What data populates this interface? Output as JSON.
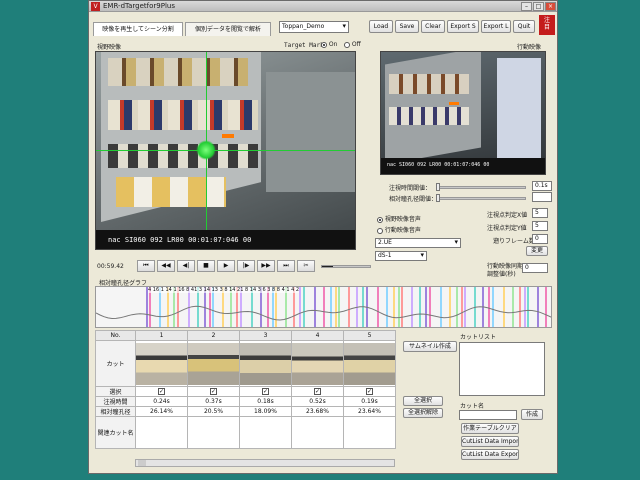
{
  "window": {
    "title": "EMR-dTargetfor9Plus",
    "app_icon_text": "V"
  },
  "tabs": [
    {
      "label": "映像を再生してシーン分割",
      "active": true
    },
    {
      "label": "個別データを閲覧で解析",
      "active": false
    }
  ],
  "project_select": "Toppan_Demo",
  "toolbar": [
    "Load",
    "Save",
    "Clear",
    "Export S",
    "Export L",
    "Quit"
  ],
  "corner_logo": "注\n目",
  "left_panel": {
    "title": "視野映像",
    "target_mark_label": "Target Mark",
    "target_on": "On",
    "target_off": "Off",
    "timecode": "nac  SI060  092  LR00  00:01:07:046     00"
  },
  "right_panel": {
    "title": "行動映像",
    "timecode": "nac  SI060  092  LR00  00:01:07:046     00",
    "gaze_threshold_label": "注視時間閾値：",
    "gaze_threshold_value": "0.1s",
    "pupil_threshold_label": "相対瞳孔径閾値：",
    "audio_radio_1": "視野映像音声",
    "audio_radio_2": "行動映像音声",
    "audio_radio_selected": 0,
    "select_1": "2.UE",
    "select_2": "dS-1",
    "fix_x_label": "注視点判定X値",
    "fix_x_value": "5",
    "fix_y_label": "注視点判定Y値",
    "fix_y_value": "5",
    "frame_skip_label": "遡りフレーム数",
    "frame_skip_value": "0",
    "change_button": "変更",
    "sync_label_1": "行動映像同期",
    "sync_label_2": "調整値(秒)",
    "sync_value": "0"
  },
  "player": {
    "time": "00:59.42",
    "progress": 0.22,
    "controls": [
      "⏮",
      "◀◀",
      "◀|",
      "■",
      "▶",
      "|▶",
      "▶▶",
      "⏭",
      "✂"
    ]
  },
  "graph": {
    "title": "相対瞳孔径グラフ",
    "top_labels": "4 16 1 14 1 16 8  41  3 14  13 3 8 14 21   8 14  3 6 3 8  8  4  1 4 2"
  },
  "table": {
    "no_label": "No.",
    "cut_label": "カット",
    "select_label": "選択",
    "gaze_time_label": "注視時間",
    "pupil_label": "相対瞳孔径",
    "related_label": "関連カット名",
    "columns": [
      {
        "no": "1",
        "checked": true,
        "gaze_time": "0.24s",
        "pupil": "26.14%"
      },
      {
        "no": "2",
        "checked": true,
        "gaze_time": "0.37s",
        "pupil": "20.5%"
      },
      {
        "no": "3",
        "checked": true,
        "gaze_time": "0.18s",
        "pupil": "18.09%"
      },
      {
        "no": "4",
        "checked": true,
        "gaze_time": "0.52s",
        "pupil": "23.68%"
      },
      {
        "no": "5",
        "checked": true,
        "gaze_time": "0.19s",
        "pupil": "23.64%"
      }
    ]
  },
  "buttons": {
    "thumbnail": "サムネイル作成",
    "select_all": "全選択",
    "deselect_all": "全選択解除",
    "create": "作成",
    "clear_image_table": "作業テーブルクリア",
    "cutlist_import": "CutList Data Import",
    "cutlist_export": "CutList Data Export"
  },
  "cutlist": {
    "title": "カットリスト",
    "cut_name_label": "カット名"
  },
  "colors": {
    "desktop": "#1f7f7a",
    "window": "#ece9d8",
    "gaze_green": "#22cc33",
    "gaze_highlight": "#ff7a00"
  }
}
